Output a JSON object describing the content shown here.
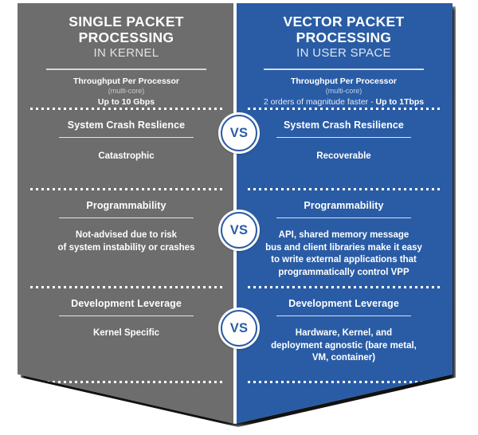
{
  "colors": {
    "left_panel": "#6d6d6d",
    "right_panel": "#2a5ca5",
    "accent": "#2a5ca5",
    "text": "#ffffff",
    "muted": "#c9c9c9"
  },
  "left": {
    "title": "SINGLE PACKET PROCESSING",
    "subtitle": "IN KERNEL",
    "metric_label": "Throughput Per Processor",
    "metric_note": "(multi-core)",
    "metric_value": "Up to 10 Gbps",
    "rows": [
      {
        "title": "System Crash Reslience",
        "body": "Catastrophic"
      },
      {
        "title": "Programmability",
        "body": "Not-advised due to risk\nof system instability or crashes"
      },
      {
        "title": "Development Leverage",
        "body": "Kernel Specific"
      }
    ]
  },
  "right": {
    "title": "VECTOR PACKET PROCESSING",
    "subtitle": "IN USER SPACE",
    "metric_label": "Throughput Per Processor",
    "metric_note": "(multi-core)",
    "metric_value_lead": "2 orders of magnitude faster - ",
    "metric_value_strong": "Up to 1Tbps",
    "rows": [
      {
        "title": "System Crash Resilience",
        "body": "Recoverable"
      },
      {
        "title": "Programmability",
        "body": "API, shared memory message\nbus and client libraries make it easy\nto write external applications that\nprogrammatically control VPP"
      },
      {
        "title": "Development Leverage",
        "body": "Hardware, Kernel, and\ndeployment agnostic (bare metal,\nVM, container)"
      }
    ]
  },
  "vs_badges": [
    {
      "label": "VS"
    },
    {
      "label": "VS"
    },
    {
      "label": "VS"
    }
  ]
}
